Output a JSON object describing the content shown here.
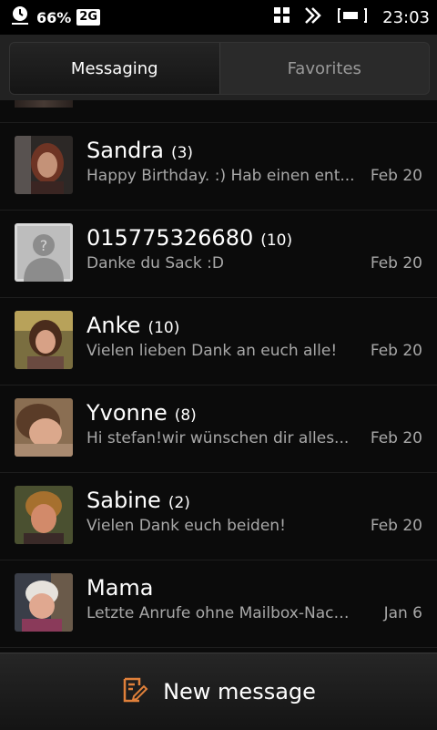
{
  "status_bar": {
    "battery_percent": "66%",
    "network": "2G",
    "time": "23:03",
    "icons": [
      "clock-icon",
      "grid-icon",
      "data-transfer-icon",
      "battery-icon"
    ]
  },
  "tabs": [
    {
      "label": "Messaging",
      "active": true
    },
    {
      "label": "Favorites",
      "active": false
    }
  ],
  "conversations": [
    {
      "name": "Sandra",
      "count": "(3)",
      "preview": "Happy Birthday. :) Hab einen ent...",
      "date": "Feb 20",
      "avatar": "photo-sandra"
    },
    {
      "name": "015775326680",
      "count": "(10)",
      "preview": "Danke du Sack :D",
      "date": "Feb 20",
      "avatar": "placeholder-person-icon"
    },
    {
      "name": "Anke",
      "count": "(10)",
      "preview": "Vielen lieben Dank an euch alle!",
      "date": "Feb 20",
      "avatar": "photo-anke"
    },
    {
      "name": "Yvonne",
      "count": "(8)",
      "preview": "Hi stefan!wir wünschen dir alles...",
      "date": "Feb 20",
      "avatar": "photo-yvonne"
    },
    {
      "name": "Sabine",
      "count": "(2)",
      "preview": "Vielen Dank euch beiden!",
      "date": "Feb 20",
      "avatar": "photo-sabine"
    },
    {
      "name": "Mama",
      "count": "",
      "preview": "Letzte Anrufe ohne Mailbox-Nach...",
      "date": "Jan 6",
      "avatar": "photo-mama"
    }
  ],
  "bottom_bar": {
    "label": "New message",
    "icon": "compose-icon",
    "accent": "#e0803a"
  }
}
